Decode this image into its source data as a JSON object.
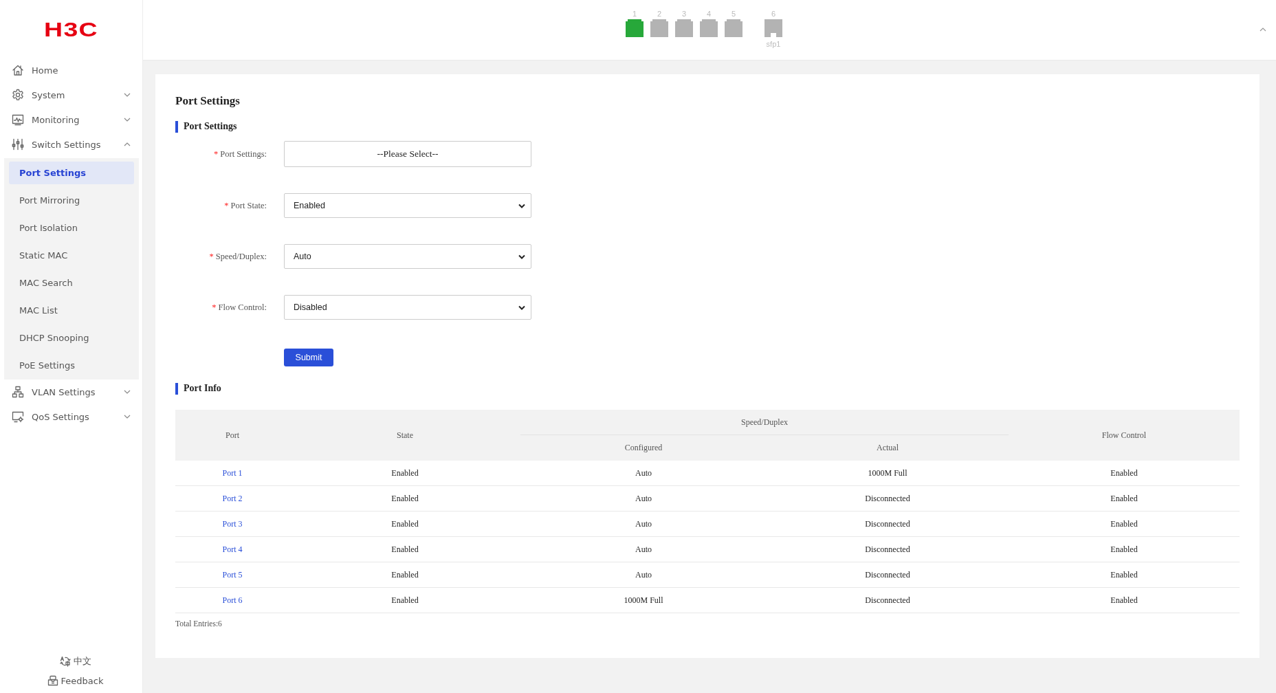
{
  "sidebar": {
    "logo": "H3C",
    "items": [
      {
        "label": "Home"
      },
      {
        "label": "System",
        "expanded": false
      },
      {
        "label": "Monitoring",
        "expanded": false
      },
      {
        "label": "Switch Settings",
        "expanded": true,
        "children": [
          {
            "label": "Port Settings",
            "selected": true
          },
          {
            "label": "Port Mirroring",
            "selected": false
          },
          {
            "label": "Port Isolation",
            "selected": false
          },
          {
            "label": "Static MAC",
            "selected": false
          },
          {
            "label": "MAC Search",
            "selected": false
          },
          {
            "label": "MAC List",
            "selected": false
          },
          {
            "label": "DHCP Snooping",
            "selected": false
          },
          {
            "label": "PoE Settings",
            "selected": false
          }
        ]
      },
      {
        "label": "VLAN Settings",
        "expanded": false
      },
      {
        "label": "QoS Settings",
        "expanded": false
      }
    ],
    "language": "中文",
    "feedback": "Feedback"
  },
  "ports": [
    {
      "number": "1",
      "kind": "rj45",
      "connected": true
    },
    {
      "number": "2",
      "kind": "rj45",
      "connected": false
    },
    {
      "number": "3",
      "kind": "rj45",
      "connected": false
    },
    {
      "number": "4",
      "kind": "rj45",
      "connected": false
    },
    {
      "number": "5",
      "kind": "rj45",
      "connected": false
    },
    {
      "number": "6",
      "kind": "sfp",
      "connected": false,
      "label": "sfp1"
    }
  ],
  "page": {
    "title": "Port Settings",
    "form_section": "Port Settings",
    "fields": [
      {
        "label": "Port Settings:",
        "required_mark": "*",
        "kind": "picker",
        "prompt": "--Please Select--"
      },
      {
        "label": "Port State:",
        "required_mark": "*",
        "kind": "select",
        "value": "Enabled"
      },
      {
        "label": "Speed/Duplex:",
        "required_mark": "*",
        "kind": "select",
        "value": "Auto"
      },
      {
        "label": "Flow Control:",
        "required_mark": "*",
        "kind": "select",
        "value": "Disabled"
      }
    ],
    "submit": "Submit",
    "info_section": "Port Info",
    "table": {
      "columns": {
        "port": "Port",
        "state": "State",
        "speed_duplex": "Speed/Duplex",
        "configured": "Configured",
        "actual": "Actual",
        "flow_control": "Flow Control"
      },
      "rows": [
        {
          "port": "Port 1",
          "state": "Enabled",
          "configured": "Auto",
          "actual": "1000M Full",
          "flow_control": "Enabled"
        },
        {
          "port": "Port 2",
          "state": "Enabled",
          "configured": "Auto",
          "actual": "Disconnected",
          "flow_control": "Enabled"
        },
        {
          "port": "Port 3",
          "state": "Enabled",
          "configured": "Auto",
          "actual": "Disconnected",
          "flow_control": "Enabled"
        },
        {
          "port": "Port 4",
          "state": "Enabled",
          "configured": "Auto",
          "actual": "Disconnected",
          "flow_control": "Enabled"
        },
        {
          "port": "Port 5",
          "state": "Enabled",
          "configured": "Auto",
          "actual": "Disconnected",
          "flow_control": "Enabled"
        },
        {
          "port": "Port 6",
          "state": "Enabled",
          "configured": "1000M Full",
          "actual": "Disconnected",
          "flow_control": "Enabled"
        }
      ],
      "total": "Total Entries:6"
    }
  }
}
